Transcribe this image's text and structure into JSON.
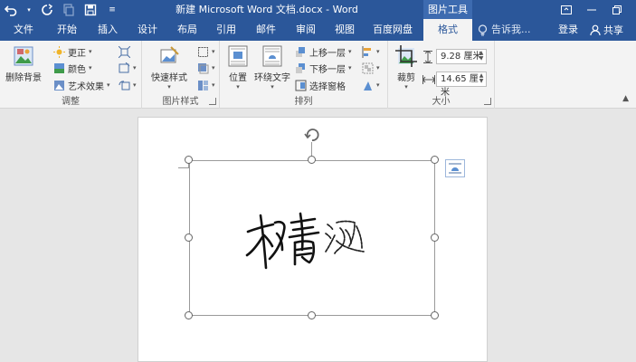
{
  "window": {
    "title": "新建 Microsoft Word 文档.docx - Word",
    "context_group": "图片工具"
  },
  "tabs": [
    {
      "label": "文件",
      "active": false
    },
    {
      "label": "开始",
      "active": false
    },
    {
      "label": "插入",
      "active": false
    },
    {
      "label": "设计",
      "active": false
    },
    {
      "label": "布局",
      "active": false
    },
    {
      "label": "引用",
      "active": false
    },
    {
      "label": "邮件",
      "active": false
    },
    {
      "label": "审阅",
      "active": false
    },
    {
      "label": "视图",
      "active": false
    },
    {
      "label": "百度网盘",
      "active": false
    },
    {
      "label": "格式",
      "active": true
    }
  ],
  "tell_me": "告诉我...",
  "sign_in": "登录",
  "share": "共享",
  "ribbon": {
    "adjust": {
      "label": "调整",
      "remove_bg": "删除背景",
      "corrections": "更正",
      "color": "颜色",
      "artistic": "艺术效果"
    },
    "styles": {
      "label": "图片样式",
      "quick_styles": "快速样式"
    },
    "arrange": {
      "label": "排列",
      "position": "位置",
      "wrap_text": "环绕文字",
      "bring_forward": "上移一层",
      "send_backward": "下移一层",
      "selection_pane": "选择窗格"
    },
    "size": {
      "label": "大小",
      "crop": "裁剪",
      "height": "9.28 厘米",
      "width": "14.65 厘米"
    }
  },
  "colors": {
    "accent": "#2b579a",
    "ribbon_bg": "#f3f3f3",
    "workspace_bg": "#e6e6e6"
  }
}
